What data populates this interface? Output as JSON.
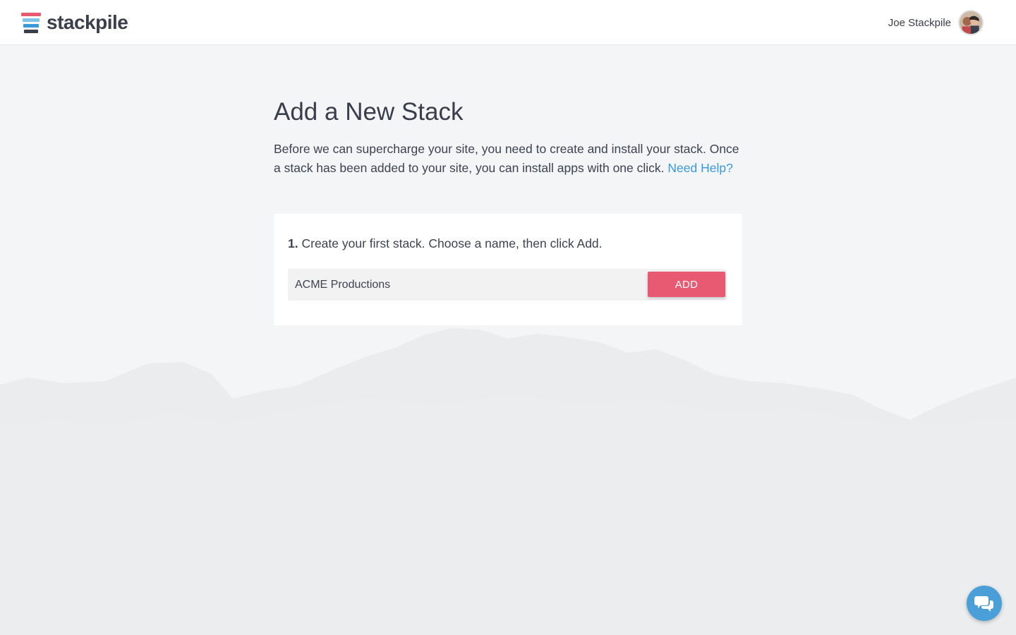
{
  "brand": {
    "name": "stackpile",
    "logo_colors": [
      "#e85a71",
      "#7fc4e8",
      "#3a9ad9",
      "#3b3f4c"
    ]
  },
  "header": {
    "user_name": "Joe Stackpile",
    "avatar_icon": "user-avatar"
  },
  "main": {
    "title": "Add a New Stack",
    "intro": "Before we can supercharge your site, you need to create and install your stack. Once a stack has been added to your site, you can install apps with one click.",
    "help_link": "Need Help?"
  },
  "card": {
    "step_number": "1.",
    "step_text": "Create your first stack. Choose a name, then click Add.",
    "input_value": "ACME Productions",
    "add_label": "ADD"
  },
  "chat": {
    "icon": "chat-bubbles-icon"
  },
  "colors": {
    "accent": "#e85a71",
    "link": "#3a9ad9",
    "chat": "#4a9fd8",
    "background": "#f4f5f7"
  }
}
